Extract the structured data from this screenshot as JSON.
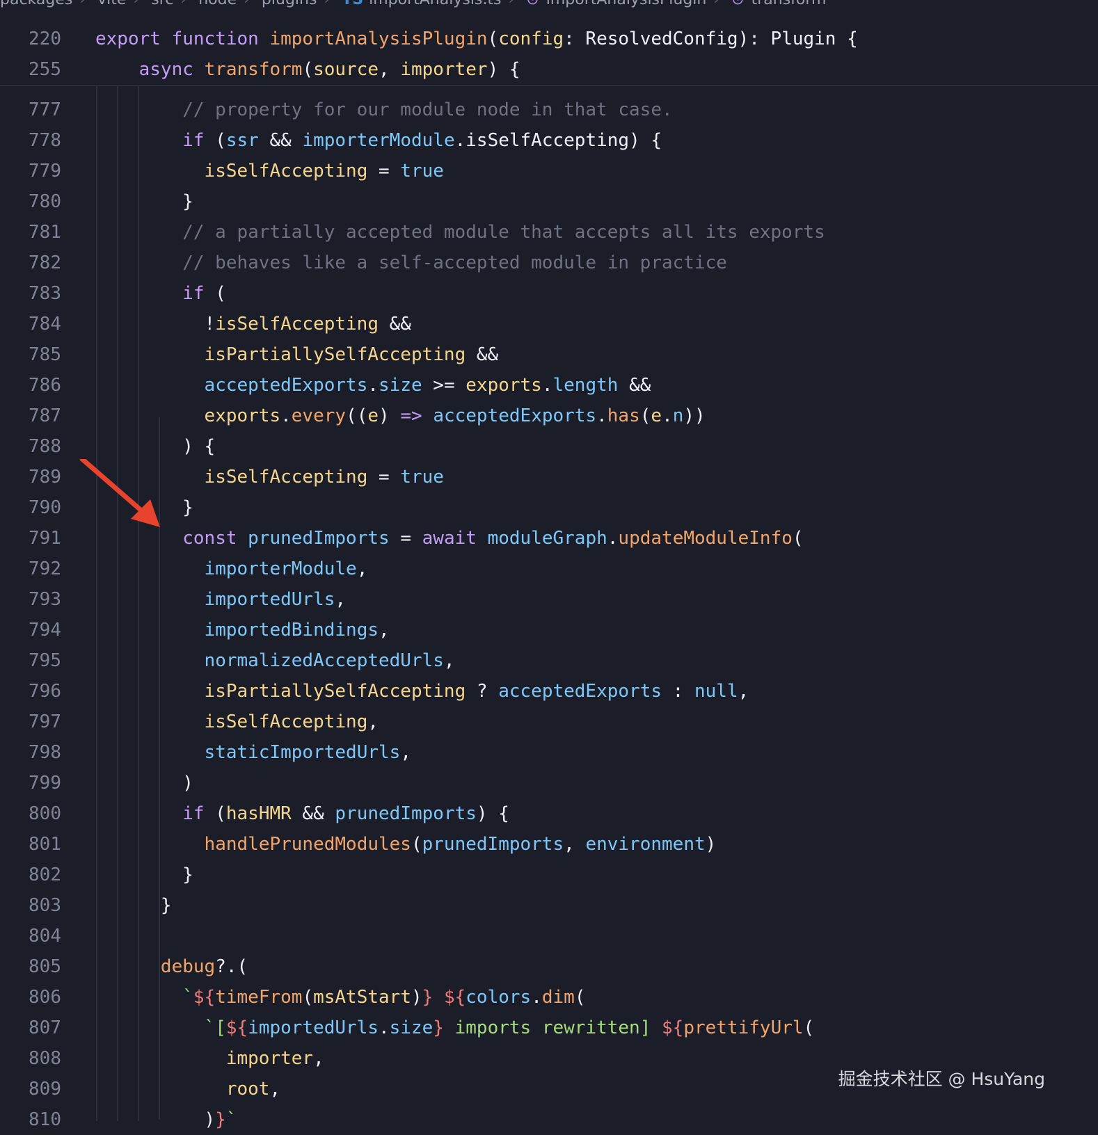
{
  "breadcrumb": {
    "items": [
      "packages",
      "vite",
      "src",
      "node",
      "plugins",
      "importAnalysis.ts",
      "importAnalysisPlugin",
      "transform"
    ],
    "ts_badge": "TS"
  },
  "sticky_lines": [
    {
      "number": "220",
      "tokens": [
        [
          "k",
          "export"
        ],
        [
          "t",
          " "
        ],
        [
          "k",
          "function"
        ],
        [
          "t",
          " "
        ],
        [
          "f",
          "importAnalysisPlugin"
        ],
        [
          "t",
          "("
        ],
        [
          "v",
          "config"
        ],
        [
          "t",
          ": ResolvedConfig): Plugin {"
        ]
      ]
    },
    {
      "number": "255",
      "tokens": [
        [
          "t",
          "    "
        ],
        [
          "k",
          "async"
        ],
        [
          "t",
          " "
        ],
        [
          "f",
          "transform"
        ],
        [
          "t",
          "("
        ],
        [
          "v",
          "source"
        ],
        [
          "t",
          ", "
        ],
        [
          "v",
          "importer"
        ],
        [
          "t",
          ") {"
        ]
      ]
    }
  ],
  "lines": [
    {
      "number": "777",
      "tokens": [
        [
          "c",
          "        // property for our module node in that case."
        ]
      ]
    },
    {
      "number": "778",
      "tokens": [
        [
          "t",
          "        "
        ],
        [
          "k",
          "if"
        ],
        [
          "t",
          " ("
        ],
        [
          "p",
          "ssr"
        ],
        [
          "t",
          " && "
        ],
        [
          "p",
          "importerModule"
        ],
        [
          "t",
          ".isSelfAccepting) {"
        ]
      ]
    },
    {
      "number": "779",
      "tokens": [
        [
          "t",
          "          "
        ],
        [
          "v",
          "isSelfAccepting"
        ],
        [
          "t",
          " = "
        ],
        [
          "p",
          "true"
        ]
      ]
    },
    {
      "number": "780",
      "tokens": [
        [
          "t",
          "        }"
        ]
      ]
    },
    {
      "number": "781",
      "tokens": [
        [
          "c",
          "        // a partially accepted module that accepts all its exports"
        ]
      ]
    },
    {
      "number": "782",
      "tokens": [
        [
          "c",
          "        // behaves like a self-accepted module in practice"
        ]
      ]
    },
    {
      "number": "783",
      "tokens": [
        [
          "t",
          "        "
        ],
        [
          "k",
          "if"
        ],
        [
          "t",
          " ("
        ]
      ]
    },
    {
      "number": "784",
      "tokens": [
        [
          "t",
          "          !"
        ],
        [
          "v",
          "isSelfAccepting"
        ],
        [
          "t",
          " &&"
        ]
      ]
    },
    {
      "number": "785",
      "tokens": [
        [
          "t",
          "          "
        ],
        [
          "v",
          "isPartiallySelfAccepting"
        ],
        [
          "t",
          " &&"
        ]
      ]
    },
    {
      "number": "786",
      "tokens": [
        [
          "t",
          "          "
        ],
        [
          "p",
          "acceptedExports"
        ],
        [
          "t",
          "."
        ],
        [
          "p",
          "size"
        ],
        [
          "t",
          " >= "
        ],
        [
          "v",
          "exports"
        ],
        [
          "t",
          "."
        ],
        [
          "p",
          "length"
        ],
        [
          "t",
          " &&"
        ]
      ]
    },
    {
      "number": "787",
      "tokens": [
        [
          "t",
          "          "
        ],
        [
          "v",
          "exports"
        ],
        [
          "t",
          "."
        ],
        [
          "f",
          "every"
        ],
        [
          "t",
          "(("
        ],
        [
          "v",
          "e"
        ],
        [
          "t",
          ") "
        ],
        [
          "k",
          "=>"
        ],
        [
          "t",
          " "
        ],
        [
          "p",
          "acceptedExports"
        ],
        [
          "t",
          "."
        ],
        [
          "f",
          "has"
        ],
        [
          "t",
          "("
        ],
        [
          "v",
          "e"
        ],
        [
          "t",
          "."
        ],
        [
          "p",
          "n"
        ],
        [
          "t",
          "))"
        ]
      ]
    },
    {
      "number": "788",
      "tokens": [
        [
          "t",
          "        ) {"
        ]
      ]
    },
    {
      "number": "789",
      "tokens": [
        [
          "t",
          "          "
        ],
        [
          "v",
          "isSelfAccepting"
        ],
        [
          "t",
          " = "
        ],
        [
          "p",
          "true"
        ]
      ]
    },
    {
      "number": "790",
      "tokens": [
        [
          "t",
          "        }"
        ]
      ]
    },
    {
      "number": "791",
      "tokens": [
        [
          "t",
          "        "
        ],
        [
          "k",
          "const"
        ],
        [
          "t",
          " "
        ],
        [
          "p",
          "prunedImports"
        ],
        [
          "t",
          " = "
        ],
        [
          "k",
          "await"
        ],
        [
          "t",
          " "
        ],
        [
          "p",
          "moduleGraph"
        ],
        [
          "t",
          "."
        ],
        [
          "f",
          "updateModuleInfo"
        ],
        [
          "t",
          "("
        ]
      ]
    },
    {
      "number": "792",
      "tokens": [
        [
          "t",
          "          "
        ],
        [
          "p",
          "importerModule"
        ],
        [
          "t",
          ","
        ]
      ]
    },
    {
      "number": "793",
      "tokens": [
        [
          "t",
          "          "
        ],
        [
          "p",
          "importedUrls"
        ],
        [
          "t",
          ","
        ]
      ]
    },
    {
      "number": "794",
      "tokens": [
        [
          "t",
          "          "
        ],
        [
          "p",
          "importedBindings"
        ],
        [
          "t",
          ","
        ]
      ]
    },
    {
      "number": "795",
      "tokens": [
        [
          "t",
          "          "
        ],
        [
          "p",
          "normalizedAcceptedUrls"
        ],
        [
          "t",
          ","
        ]
      ]
    },
    {
      "number": "796",
      "tokens": [
        [
          "t",
          "          "
        ],
        [
          "v",
          "isPartiallySelfAccepting"
        ],
        [
          "t",
          " ? "
        ],
        [
          "p",
          "acceptedExports"
        ],
        [
          "t",
          " : "
        ],
        [
          "p",
          "null"
        ],
        [
          "t",
          ","
        ]
      ]
    },
    {
      "number": "797",
      "tokens": [
        [
          "t",
          "          "
        ],
        [
          "v",
          "isSelfAccepting"
        ],
        [
          "t",
          ","
        ]
      ]
    },
    {
      "number": "798",
      "tokens": [
        [
          "t",
          "          "
        ],
        [
          "p",
          "staticImportedUrls"
        ],
        [
          "t",
          ","
        ]
      ]
    },
    {
      "number": "799",
      "tokens": [
        [
          "t",
          "        )"
        ]
      ]
    },
    {
      "number": "800",
      "tokens": [
        [
          "t",
          "        "
        ],
        [
          "k",
          "if"
        ],
        [
          "t",
          " ("
        ],
        [
          "v",
          "hasHMR"
        ],
        [
          "t",
          " && "
        ],
        [
          "p",
          "prunedImports"
        ],
        [
          "t",
          ") {"
        ]
      ]
    },
    {
      "number": "801",
      "tokens": [
        [
          "t",
          "          "
        ],
        [
          "f",
          "handlePrunedModules"
        ],
        [
          "t",
          "("
        ],
        [
          "p",
          "prunedImports"
        ],
        [
          "t",
          ", "
        ],
        [
          "p",
          "environment"
        ],
        [
          "t",
          ")"
        ]
      ]
    },
    {
      "number": "802",
      "tokens": [
        [
          "t",
          "        }"
        ]
      ]
    },
    {
      "number": "803",
      "tokens": [
        [
          "t",
          "      }"
        ]
      ]
    },
    {
      "number": "804",
      "tokens": []
    },
    {
      "number": "805",
      "tokens": [
        [
          "t",
          "      "
        ],
        [
          "f",
          "debug"
        ],
        [
          "t",
          "?.("
        ]
      ]
    },
    {
      "number": "806",
      "tokens": [
        [
          "t",
          "        "
        ],
        [
          "s",
          "`"
        ],
        [
          "tp",
          "${"
        ],
        [
          "f",
          "timeFrom"
        ],
        [
          "t",
          "("
        ],
        [
          "v",
          "msAtStart"
        ],
        [
          "t",
          ")"
        ],
        [
          "tp",
          "}"
        ],
        [
          "s",
          " "
        ],
        [
          "tp",
          "${"
        ],
        [
          "p",
          "colors"
        ],
        [
          "t",
          "."
        ],
        [
          "f",
          "dim"
        ],
        [
          "t",
          "("
        ]
      ]
    },
    {
      "number": "807",
      "tokens": [
        [
          "t",
          "          "
        ],
        [
          "s",
          "`["
        ],
        [
          "tp",
          "${"
        ],
        [
          "p",
          "importedUrls"
        ],
        [
          "t",
          "."
        ],
        [
          "p",
          "size"
        ],
        [
          "tp",
          "}"
        ],
        [
          "s",
          " imports rewritten] "
        ],
        [
          "tp",
          "${"
        ],
        [
          "f",
          "prettifyUrl"
        ],
        [
          "t",
          "("
        ]
      ]
    },
    {
      "number": "808",
      "tokens": [
        [
          "t",
          "            "
        ],
        [
          "v",
          "importer"
        ],
        [
          "t",
          ","
        ]
      ]
    },
    {
      "number": "809",
      "tokens": [
        [
          "t",
          "            "
        ],
        [
          "v",
          "root"
        ],
        [
          "t",
          ","
        ]
      ]
    },
    {
      "number": "810",
      "tokens": [
        [
          "t",
          "          )"
        ],
        [
          "tp",
          "}"
        ],
        [
          "s",
          "`"
        ]
      ]
    }
  ],
  "colors": {
    "background": "#1b1e28",
    "arrow": "#e8432c"
  },
  "annotation": {
    "icon": "red-arrow-icon"
  },
  "watermark": "掘金技术社区 @ HsuYang"
}
